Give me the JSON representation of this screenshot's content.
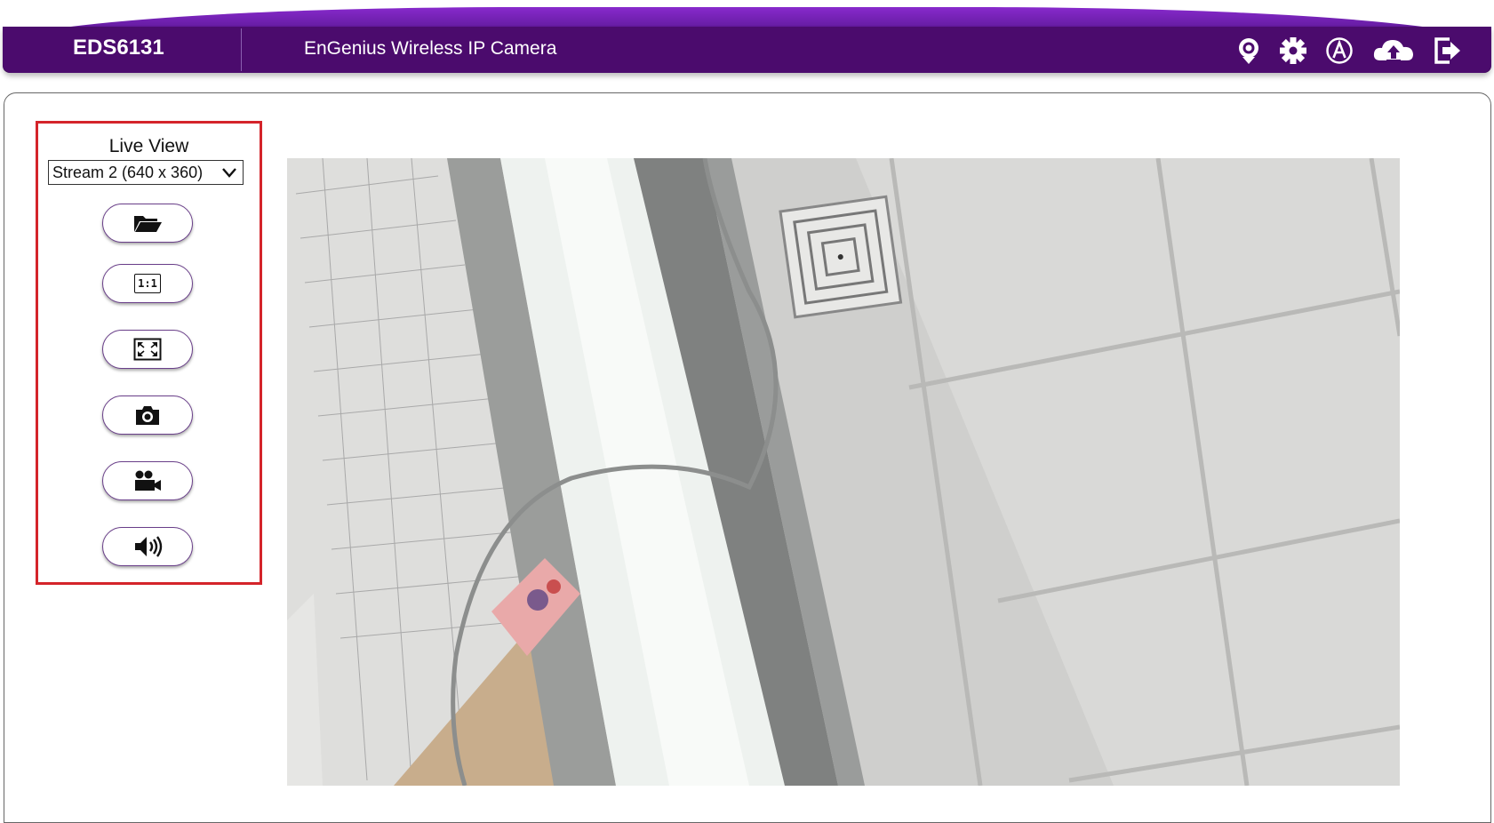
{
  "header": {
    "model": "EDS6131",
    "product_name": "EnGenius Wireless IP Camera",
    "icons": [
      "live-view-icon",
      "settings-gear-icon",
      "admin-icon",
      "cloud-upload-icon",
      "logout-icon"
    ],
    "accent_color": "#4b0b6d"
  },
  "side_panel": {
    "title": "Live View",
    "stream_select": {
      "value": "Stream 2 (640 x 360)"
    },
    "buttons": [
      "folder-icon",
      "actual-size-icon",
      "fullscreen-icon",
      "snapshot-icon",
      "record-video-icon",
      "audio-speaker-icon"
    ],
    "actual_size_label": "1:1",
    "highlight_color": "#d4242a"
  }
}
